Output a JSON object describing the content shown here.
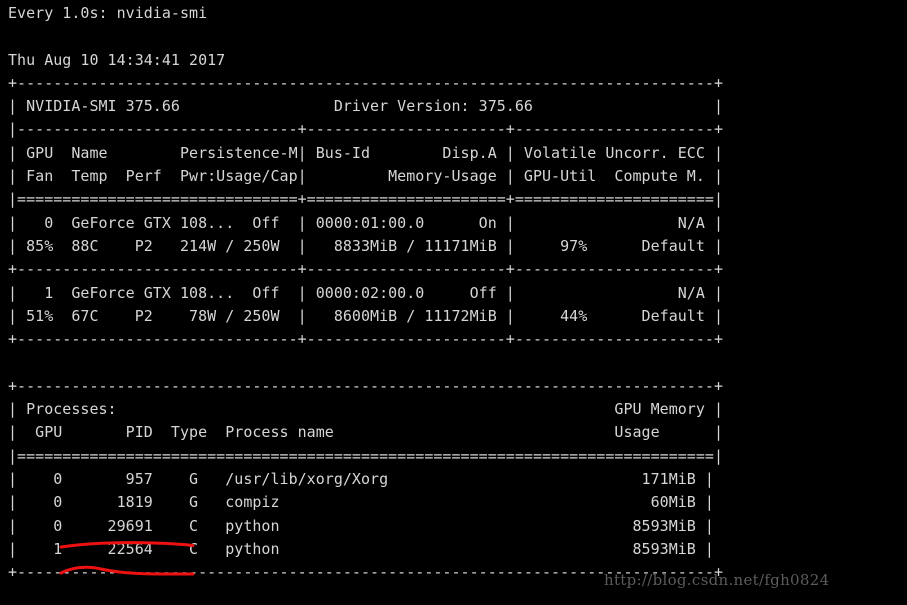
{
  "terminal": {
    "watch_header": "Every 1.0s: nvidia-smi",
    "timestamp": "Thu Aug 10 14:34:41 2017",
    "foreground_color": "#d6d6d6",
    "background_color": "#000000"
  },
  "smi_header": {
    "tool_label": "NVIDIA-SMI 375.66",
    "driver_label": "Driver Version: 375.66"
  },
  "gpu_table": {
    "column_headers_row1": [
      "GPU",
      "Name",
      "Persistence-M",
      "Bus-Id",
      "Disp.A",
      "Volatile Uncorr. ECC"
    ],
    "column_headers_row2": [
      "Fan",
      "Temp",
      "Perf",
      "Pwr:Usage/Cap",
      "Memory-Usage",
      "GPU-Util",
      "Compute M."
    ],
    "rows": [
      {
        "gpu": "0",
        "name": "GeForce GTX 108...",
        "persistence_m": "Off",
        "bus_id": "0000:01:00.0",
        "disp_a": "On",
        "ecc": "N/A",
        "fan": "85%",
        "temp": "88C",
        "perf": "P2",
        "pwr_usage_cap": "214W / 250W",
        "memory_usage": "8833MiB / 11171MiB",
        "gpu_util": "97%",
        "compute_m": "Default"
      },
      {
        "gpu": "1",
        "name": "GeForce GTX 108...",
        "persistence_m": "Off",
        "bus_id": "0000:02:00.0",
        "disp_a": "Off",
        "ecc": "N/A",
        "fan": "51%",
        "temp": "67C",
        "perf": "P2",
        "pwr_usage_cap": "78W / 250W",
        "memory_usage": "8600MiB / 11172MiB",
        "gpu_util": "44%",
        "compute_m": "Default"
      }
    ]
  },
  "processes_table": {
    "title": "Processes:",
    "memory_header_line1": "GPU Memory",
    "memory_header_line2": "Usage",
    "column_headers": [
      "GPU",
      "PID",
      "Type",
      "Process name"
    ],
    "rows": [
      {
        "gpu": "0",
        "pid": "957",
        "type": "G",
        "process_name": "/usr/lib/xorg/Xorg",
        "gpu_memory_usage": "171MiB"
      },
      {
        "gpu": "0",
        "pid": "1819",
        "type": "G",
        "process_name": "compiz",
        "gpu_memory_usage": "60MiB"
      },
      {
        "gpu": "0",
        "pid": "29691",
        "type": "C",
        "process_name": "python",
        "gpu_memory_usage": "8593MiB"
      },
      {
        "gpu": "1",
        "pid": "22564",
        "type": "C",
        "process_name": "python",
        "gpu_memory_usage": "8593MiB"
      }
    ]
  },
  "annotations": {
    "highlight_color": "#ee1111",
    "underline_target_row_index": 3,
    "strokes": [
      "underline-above-row",
      "underline-below-row"
    ]
  },
  "watermark": {
    "text": "http://blog.csdn.net/fgh0824",
    "color": "#6b6b6b"
  },
  "screen_text": {
    "line_01": "Every 1.0s: nvidia-smi",
    "line_02": "",
    "line_03": "Thu Aug 10 14:34:41 2017",
    "line_04": "+-----------------------------------------------------------------------------+",
    "line_05": "| NVIDIA-SMI 375.66                 Driver Version: 375.66                    |",
    "line_06": "|-------------------------------+----------------------+----------------------+",
    "line_07": "| GPU  Name        Persistence-M| Bus-Id        Disp.A | Volatile Uncorr. ECC |",
    "line_08": "| Fan  Temp  Perf  Pwr:Usage/Cap|         Memory-Usage | GPU-Util  Compute M. |",
    "line_09": "|===============================+======================+======================|",
    "line_10": "|   0  GeForce GTX 108...  Off  | 0000:01:00.0      On |                  N/A |",
    "line_11": "| 85%  88C    P2   214W / 250W  |   8833MiB / 11171MiB |     97%      Default |",
    "line_12": "+-------------------------------+----------------------+----------------------+",
    "line_13": "|   1  GeForce GTX 108...  Off  | 0000:02:00.0     Off |                  N/A |",
    "line_14": "| 51%  67C    P2    78W / 250W  |   8600MiB / 11172MiB |     44%      Default |",
    "line_15": "+-------------------------------+----------------------+----------------------+",
    "line_16": "",
    "line_17": "+-----------------------------------------------------------------------------+",
    "line_18": "| Processes:                                                       GPU Memory |",
    "line_19": "|  GPU       PID  Type  Process name                               Usage      |",
    "line_20": "|=============================================================================|",
    "line_21": "|    0       957    G   /usr/lib/xorg/Xorg                            171MiB |",
    "line_22": "|    0      1819    G   compiz                                         60MiB |",
    "line_23": "|    0     29691    C   python                                       8593MiB |",
    "line_24": "|    1     22564    C   python                                       8593MiB |",
    "line_25": "+-----------------------------------------------------------------------------+"
  }
}
